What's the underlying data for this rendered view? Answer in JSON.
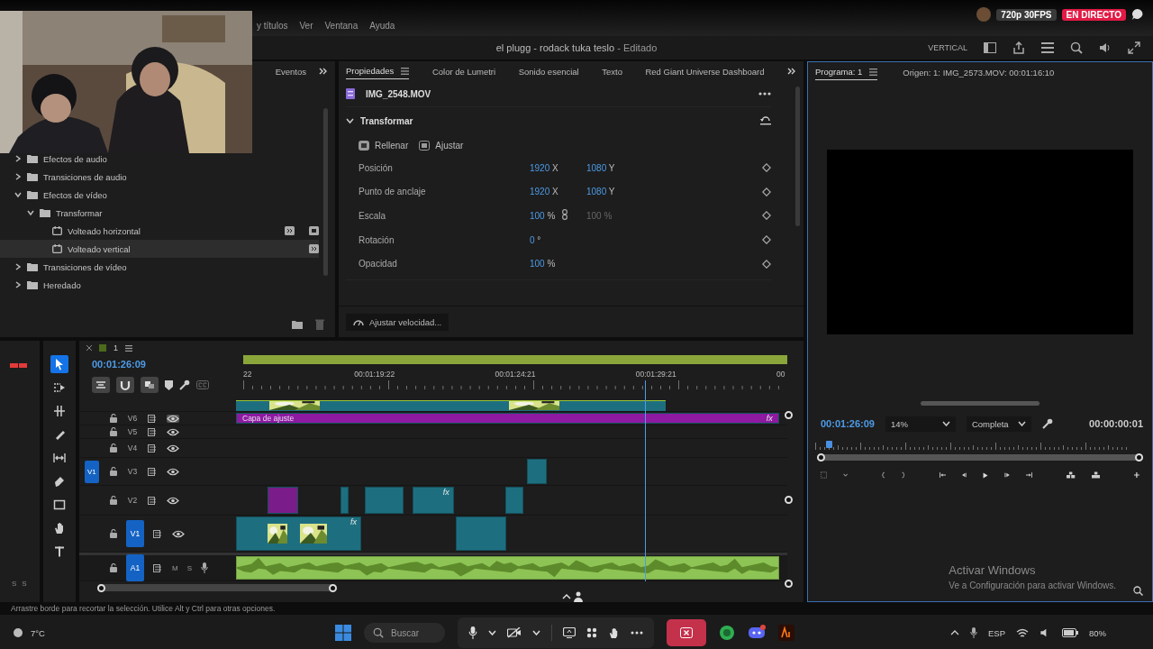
{
  "stream_bar": {
    "menu": [
      "y títulos",
      "Ver",
      "Ventana",
      "Ayuda"
    ],
    "quality": "720p 30FPS",
    "live": "EN DIRECTO"
  },
  "title_bar": {
    "title": "el plugg - rodack tuka teslo",
    "status": "- Editado",
    "workspace": "VERTICAL"
  },
  "effects_panel": {
    "tab": "Eventos",
    "tree": [
      {
        "label": "Efectos de audio",
        "kind": "folder",
        "expanded": false,
        "selected": false
      },
      {
        "label": "Transiciones de audio",
        "kind": "folder",
        "expanded": false,
        "selected": false
      },
      {
        "label": "Efectos de vídeo",
        "kind": "folder",
        "expanded": true,
        "selected": false,
        "children": [
          {
            "label": "Transformar",
            "kind": "folder",
            "expanded": true,
            "selected": false,
            "children": [
              {
                "label": "Volteado horizontal",
                "kind": "effect",
                "selected": false,
                "accelerated": true,
                "bit32": true
              },
              {
                "label": "Volteado vertical",
                "kind": "effect",
                "selected": true,
                "accelerated": true,
                "bit32": false
              }
            ]
          }
        ]
      },
      {
        "label": "Transiciones de vídeo",
        "kind": "folder",
        "expanded": false,
        "selected": false
      },
      {
        "label": "Heredado",
        "kind": "folder",
        "expanded": false,
        "selected": false
      }
    ]
  },
  "properties_panel": {
    "tabs": [
      {
        "label": "Propiedades",
        "selected": true
      },
      {
        "label": "Color de Lumetri",
        "selected": false
      },
      {
        "label": "Sonido esencial",
        "selected": false
      },
      {
        "label": "Texto",
        "selected": false
      },
      {
        "label": "Red Giant Universe Dashboard",
        "selected": false
      }
    ],
    "clip": "IMG_2548.MOV",
    "section": "Transformar",
    "expanded": true,
    "fit_options": [
      "Rellenar",
      "Ajustar"
    ],
    "rows": [
      {
        "label": "Posición",
        "value": "1920",
        "unit": "X",
        "second": {
          "value": "1080",
          "unit": "Y",
          "disabled": false
        },
        "linked": false
      },
      {
        "label": "Punto de anclaje",
        "value": "1920",
        "unit": "X",
        "second": {
          "value": "1080",
          "unit": "Y",
          "disabled": false
        },
        "linked": false
      },
      {
        "label": "Escala",
        "value": "100",
        "unit": "%",
        "second": {
          "value": "100",
          "unit": "%",
          "disabled": true
        },
        "linked": true
      },
      {
        "label": "Rotación",
        "value": "0",
        "unit": "°",
        "linked": false
      },
      {
        "label": "Opacidad",
        "value": "100",
        "unit": "%",
        "linked": false
      }
    ],
    "speed_button": "Ajustar velocidad..."
  },
  "program_monitor": {
    "tab": "Programa: 1",
    "source": "Origen: 1: IMG_2573.MOV: 00:01:16:10",
    "timecode": "00:01:26:09",
    "zoom": "14%",
    "quality": "Completa",
    "duration": "00:00:00:01",
    "notice_title": "Activar Windows",
    "notice_text": "Ve a Configuración para activar Windows."
  },
  "timeline": {
    "sequence": "1",
    "timecode": "00:01:26:09",
    "ruler": [
      "22",
      "00:01:19:22",
      "00:01:24:21",
      "00:01:29:21",
      "00"
    ],
    "tools": [
      {
        "kind": "select",
        "selected": true
      },
      {
        "kind": "track-select",
        "selected": false
      },
      {
        "kind": "ripple",
        "selected": false
      },
      {
        "kind": "razor",
        "selected": false
      },
      {
        "kind": "slip",
        "selected": false
      },
      {
        "kind": "pen",
        "selected": false
      },
      {
        "kind": "rectangle",
        "selected": false
      },
      {
        "kind": "hand",
        "selected": false
      },
      {
        "kind": "type",
        "selected": false
      }
    ],
    "meter_labels": [
      "S",
      "S"
    ],
    "tracks": [
      {
        "name": "V6",
        "kind": "video",
        "targeted": false,
        "output_toggled": true,
        "clips": [
          {
            "kind": "adjustment",
            "label": "Capa de ajuste",
            "badge": "fx"
          }
        ]
      },
      {
        "name": "V5",
        "kind": "video",
        "targeted": false,
        "output_toggled": false
      },
      {
        "name": "V4",
        "kind": "video",
        "targeted": false,
        "output_toggled": false
      },
      {
        "name": "V3",
        "kind": "video",
        "source": "V1",
        "targeted": false,
        "output_toggled": false,
        "clips": [
          {
            "kind": "video"
          }
        ]
      },
      {
        "name": "V2",
        "kind": "video",
        "targeted": false,
        "output_toggled": false,
        "clips": [
          {
            "kind": "nested"
          },
          {
            "kind": "video"
          },
          {
            "kind": "video"
          },
          {
            "kind": "video",
            "badge": "fx"
          },
          {
            "kind": "video"
          }
        ]
      },
      {
        "name": "V1",
        "kind": "video",
        "targeted": true,
        "output_toggled": false,
        "clips": [
          {
            "kind": "video",
            "badge": "fx"
          },
          {
            "kind": "video"
          }
        ]
      },
      {
        "name": "A1",
        "kind": "audio",
        "targeted": true,
        "mute": "M",
        "solo": "S",
        "clips": [
          {
            "kind": "audio"
          }
        ]
      }
    ]
  },
  "status_text": "Arrastre borde para recortar la selección. Utilice Alt y Ctrl para otras opciones.",
  "taskbar": {
    "weather": "7°C",
    "search": "Buscar",
    "language": "ESP",
    "battery": "80%"
  }
}
